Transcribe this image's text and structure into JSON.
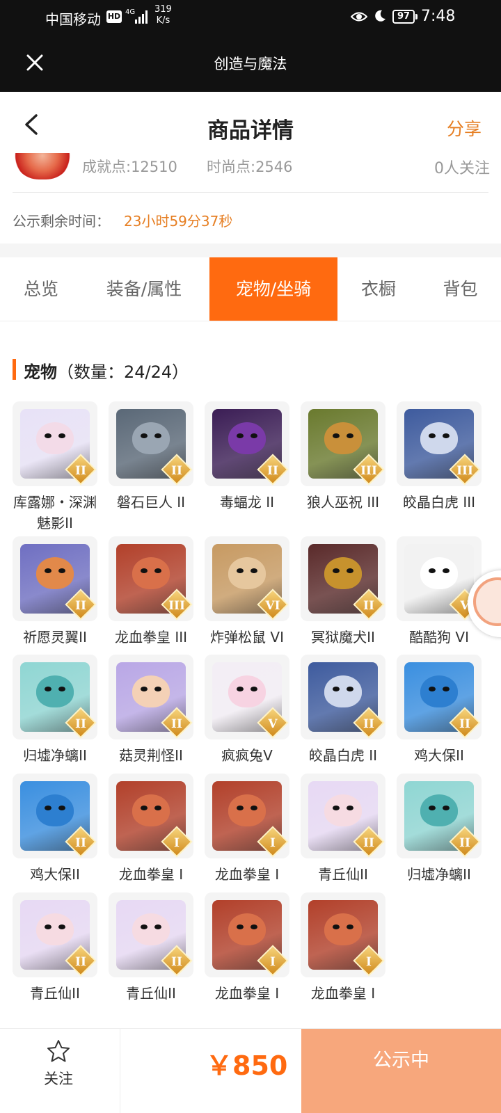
{
  "status_bar": {
    "carrier": "中国移动",
    "hd": "HD",
    "network": "4G",
    "speed_value": "319",
    "speed_unit": "K/s",
    "battery": "97",
    "time": "7:48"
  },
  "app_bar": {
    "title": "创造与魔法"
  },
  "header": {
    "title": "商品详情",
    "share": "分享"
  },
  "info": {
    "achievement": "成就点:12510",
    "fashion": "时尚点:2546",
    "followers": "0人关注",
    "publicity_label": "公示剩余时间：",
    "publicity_time": "23小时59分37秒"
  },
  "tabs": [
    "总览",
    "装备/属性",
    "宠物/坐骑",
    "衣橱",
    "背包"
  ],
  "section": {
    "title": "宠物",
    "count": "（数量：24/24）"
  },
  "pets": [
    {
      "name": "库露娜・深渊魅影II",
      "badge": "II",
      "color": "#e8e2f7",
      "face": "#f3dbe8"
    },
    {
      "name": "磐石巨人 II",
      "badge": "II",
      "color": "#5a6877",
      "face": "#9aa6b3"
    },
    {
      "name": "毒蝠龙 II",
      "badge": "II",
      "color": "#3b1d55",
      "face": "#7a3aa8"
    },
    {
      "name": "狼人巫祝 III",
      "badge": "III",
      "color": "#6a7a2e",
      "face": "#c9903a"
    },
    {
      "name": "皎晶白虎 III",
      "badge": "III",
      "color": "#3e5b9e",
      "face": "#cfd8ec"
    },
    {
      "name": "祈愿灵翼II",
      "badge": "II",
      "color": "#6f6fc2",
      "face": "#e2894a"
    },
    {
      "name": "龙血拳皇 III",
      "badge": "III",
      "color": "#b2402a",
      "face": "#d9704a"
    },
    {
      "name": "炸弹松鼠 VI",
      "badge": "VI",
      "color": "#c79a62",
      "face": "#e6c79e"
    },
    {
      "name": "冥狱魔犬II",
      "badge": "II",
      "color": "#5a2a2a",
      "face": "#c7922d"
    },
    {
      "name": "酷酷狗 VI",
      "badge": "V",
      "color": "#f2f2f2",
      "face": "#ffffff"
    },
    {
      "name": "归墟净螭II",
      "badge": "II",
      "color": "#8fd6d3",
      "face": "#4fb0b0"
    },
    {
      "name": "菇灵荆怪II",
      "badge": "II",
      "color": "#b9a7e6",
      "face": "#f4d1b6"
    },
    {
      "name": "疯疯兔V",
      "badge": "V",
      "color": "#f3eef5",
      "face": "#f7d3e2"
    },
    {
      "name": "皎晶白虎 II",
      "badge": "II",
      "color": "#3e5b9e",
      "face": "#cfd8ec"
    },
    {
      "name": "鸡大保II",
      "badge": "II",
      "color": "#3a8fe0",
      "face": "#2d7fd0"
    },
    {
      "name": "鸡大保II",
      "badge": "II",
      "color": "#3a8fe0",
      "face": "#2d7fd0"
    },
    {
      "name": "龙血拳皇 I",
      "badge": "I",
      "color": "#b2402a",
      "face": "#d9704a"
    },
    {
      "name": "龙血拳皇 I",
      "badge": "I",
      "color": "#b2402a",
      "face": "#d9704a"
    },
    {
      "name": "青丘仙II",
      "badge": "II",
      "color": "#e7d9f4",
      "face": "#f6dbe2"
    },
    {
      "name": "归墟净螭II",
      "badge": "II",
      "color": "#8fd6d3",
      "face": "#4fb0b0"
    },
    {
      "name": "青丘仙II",
      "badge": "II",
      "color": "#e7d9f4",
      "face": "#f6dbe2"
    },
    {
      "name": "青丘仙II",
      "badge": "II",
      "color": "#e7d9f4",
      "face": "#f6dbe2"
    },
    {
      "name": "龙血拳皇 I",
      "badge": "I",
      "color": "#b2402a",
      "face": "#d9704a"
    },
    {
      "name": "龙血拳皇 I",
      "badge": "I",
      "color": "#b2402a",
      "face": "#d9704a"
    }
  ],
  "bottom": {
    "follow": "关注",
    "price": "￥850",
    "cta": "公示中"
  }
}
